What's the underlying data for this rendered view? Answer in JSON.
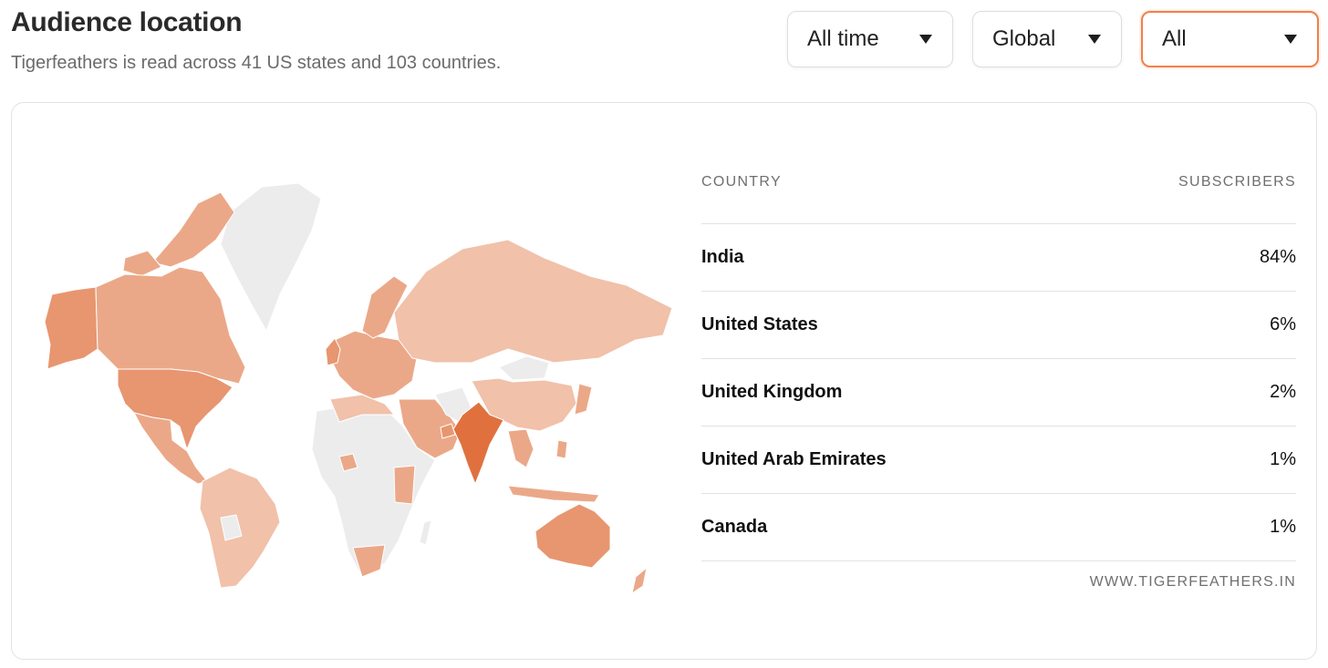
{
  "header": {
    "title": "Audience location",
    "subtitle": "Tigerfeathers is read across 41 US states and 103 countries."
  },
  "filters": {
    "time": "All time",
    "region": "Global",
    "audience": "All"
  },
  "table": {
    "col_country": "COUNTRY",
    "col_subscribers": "SUBSCRIBERS",
    "rows": [
      {
        "country": "India",
        "share": "84%"
      },
      {
        "country": "United States",
        "share": "6%"
      },
      {
        "country": "United Kingdom",
        "share": "2%"
      },
      {
        "country": "United Arab Emirates",
        "share": "1%"
      },
      {
        "country": "Canada",
        "share": "1%"
      }
    ],
    "footer": "WWW.TIGERFEATHERS.IN"
  },
  "colors": {
    "accent": "#f0804a",
    "map_highest": "#e0713f",
    "map_high": "#e79670",
    "map_mid": "#eba888",
    "map_low": "#f1c1aa",
    "map_none": "#ececec"
  }
}
